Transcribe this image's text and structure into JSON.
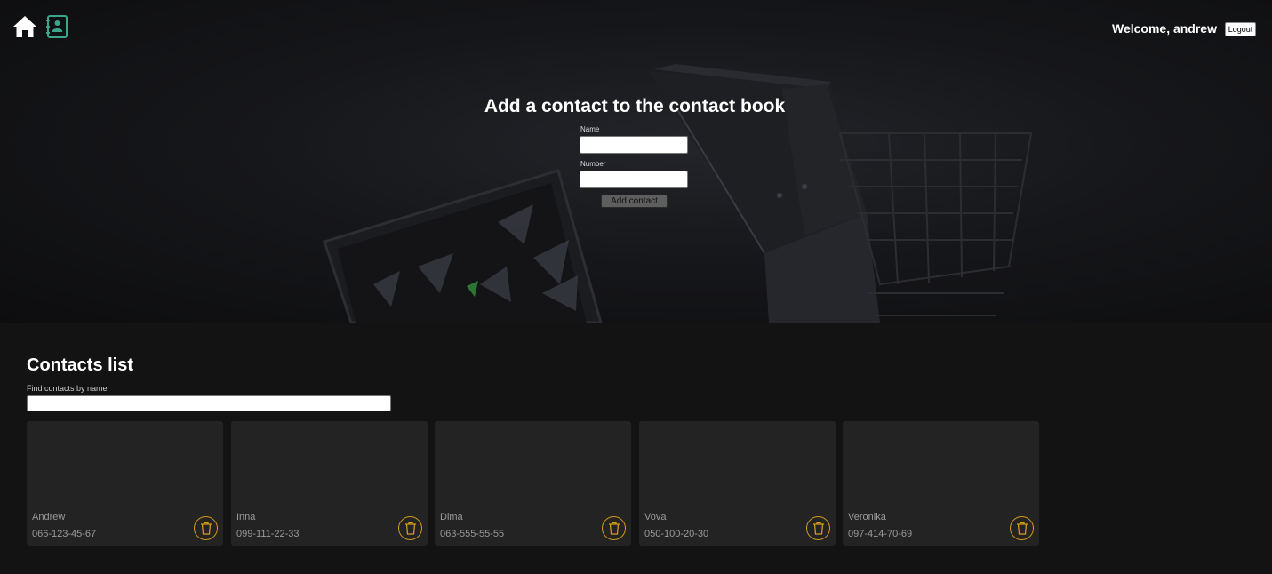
{
  "header": {
    "welcome_text": "Welcome, andrew",
    "logout_label": "Logout",
    "home_icon": "home-icon",
    "contacts_icon": "contact-book-icon",
    "accent_color": "#3aa58b"
  },
  "form": {
    "title": "Add a contact to the contact book",
    "name_label": "Name",
    "name_value": "",
    "number_label": "Number",
    "number_value": "",
    "submit_label": "Add contact"
  },
  "contacts": {
    "title": "Contacts list",
    "filter_label": "Find contacts by name",
    "filter_value": "",
    "delete_icon": "trash-icon",
    "delete_color": "#d49a1a",
    "items": [
      {
        "name": "Andrew",
        "number": "066-123-45-67"
      },
      {
        "name": "Inna",
        "number": "099-111-22-33"
      },
      {
        "name": "Dima",
        "number": "063-555-55-55"
      },
      {
        "name": "Vova",
        "number": "050-100-20-30"
      },
      {
        "name": "Veronika",
        "number": "097-414-70-69"
      }
    ]
  }
}
